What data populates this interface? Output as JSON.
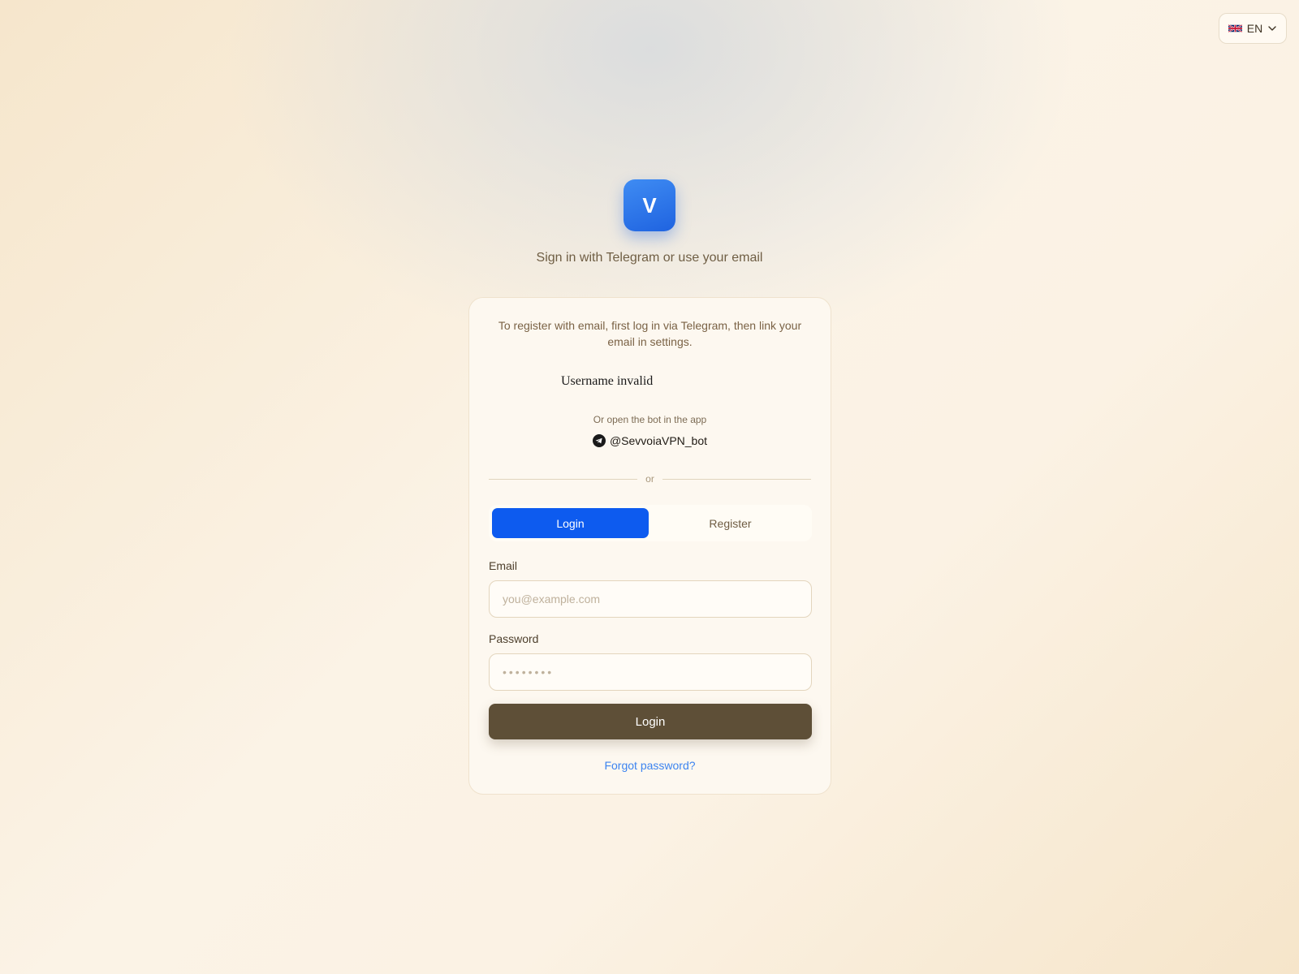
{
  "language": {
    "code": "EN",
    "flag_icon": "uk-flag-icon"
  },
  "header": {
    "logo_letter": "V",
    "subtitle": "Sign in with Telegram or use your email"
  },
  "card": {
    "note": "To register with email, first log in via Telegram, then link your email in settings.",
    "telegram_widget_error": "Username invalid",
    "bot_hint": "Or open the bot in the app",
    "bot_handle": "@SevvoiaVPN_bot",
    "divider_text": "or",
    "tabs": [
      {
        "label": "Login",
        "active": true
      },
      {
        "label": "Register",
        "active": false
      }
    ],
    "email": {
      "label": "Email",
      "placeholder": "you@example.com",
      "value": ""
    },
    "password": {
      "label": "Password",
      "placeholder": "••••••••",
      "value": ""
    },
    "submit_label": "Login",
    "forgot_label": "Forgot password?"
  },
  "colors": {
    "accent": "#0d5bef",
    "submit": "#5e4f37",
    "link": "#3d84f0"
  }
}
